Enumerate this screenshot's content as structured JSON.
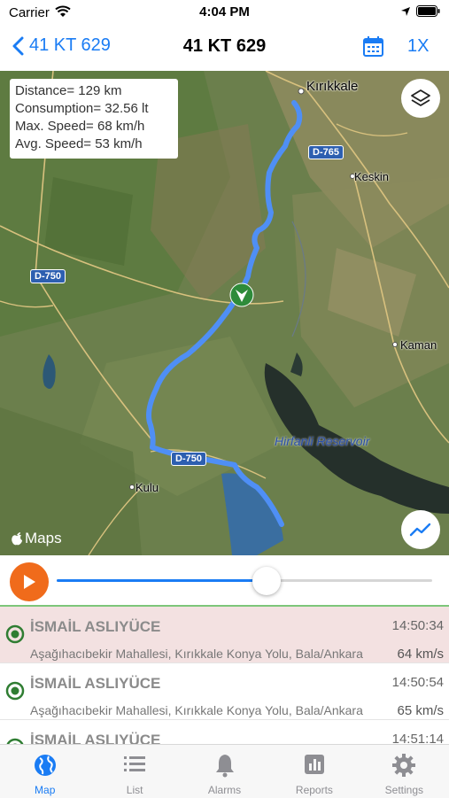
{
  "status_bar": {
    "carrier": "Carrier",
    "time": "4:04 PM"
  },
  "nav": {
    "back_label": "41 KT 629",
    "title": "41 KT 629",
    "speed_label": "1X"
  },
  "map": {
    "info": {
      "distance": "Distance= 129 km",
      "consumption": "Consumption= 32.56 lt",
      "max_speed": "Max. Speed= 68 km/h",
      "avg_speed": "Avg. Speed= 53 km/h"
    },
    "labels": {
      "kirikkale": "Kırıkkale",
      "keskin": "Keskin",
      "kaman": "Kaman",
      "kulu": "Kulu",
      "reservoir": "Hirfanli Reservoir"
    },
    "roads": {
      "d765": "D-765",
      "d750": "D-750",
      "d750b": "D-750"
    },
    "attribution": "Maps",
    "route_color": "#4f8ff5"
  },
  "playback": {
    "progress": 0.56,
    "fill_color": "#1a7cf4",
    "play_color": "#f06b1b"
  },
  "events": [
    {
      "name": "İSMAİL ASLIYÜCE",
      "time": "14:50:34",
      "address": "Aşağıhacıbekir Mahallesi, Kırıkkale Konya Yolu, Bala/Ankara",
      "speed": "64 km/s"
    },
    {
      "name": "İSMAİL ASLIYÜCE",
      "time": "14:50:54",
      "address": "Aşağıhacıbekir Mahallesi, Kırıkkale Konya Yolu, Bala/Ankara",
      "speed": "65 km/s"
    },
    {
      "name": "İSMAİL ASLIYÜCE",
      "time": "14:51:14",
      "address": "",
      "speed": ""
    }
  ],
  "tabs": [
    {
      "label": "Map",
      "icon": "globe-icon"
    },
    {
      "label": "List",
      "icon": "list-icon"
    },
    {
      "label": "Alarms",
      "icon": "bell-icon"
    },
    {
      "label": "Reports",
      "icon": "bar-chart-icon"
    },
    {
      "label": "Settings",
      "icon": "gear-icon"
    }
  ],
  "colors": {
    "accent": "#1a7cf4",
    "selected_row": "#f3e1e1",
    "row_icon": "#2f7d32"
  }
}
